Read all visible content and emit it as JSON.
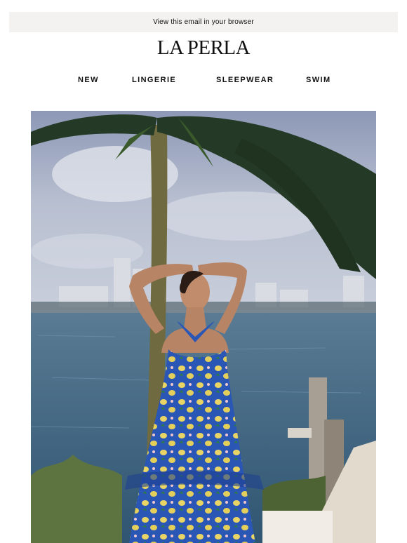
{
  "header": {
    "browser_link": "View this email in your browser",
    "logo": "LA PERLA"
  },
  "nav": {
    "items": [
      {
        "label": "NEW"
      },
      {
        "label": "LINGERIE"
      },
      {
        "label": "SLEEPWEAR"
      },
      {
        "label": "SWIM"
      }
    ]
  },
  "hero": {
    "image_alt": "",
    "colors": {
      "sky": "#a9b3c8",
      "water": "#4e7089",
      "dress": "#2a56b6",
      "lemon": "#e9d565"
    }
  }
}
